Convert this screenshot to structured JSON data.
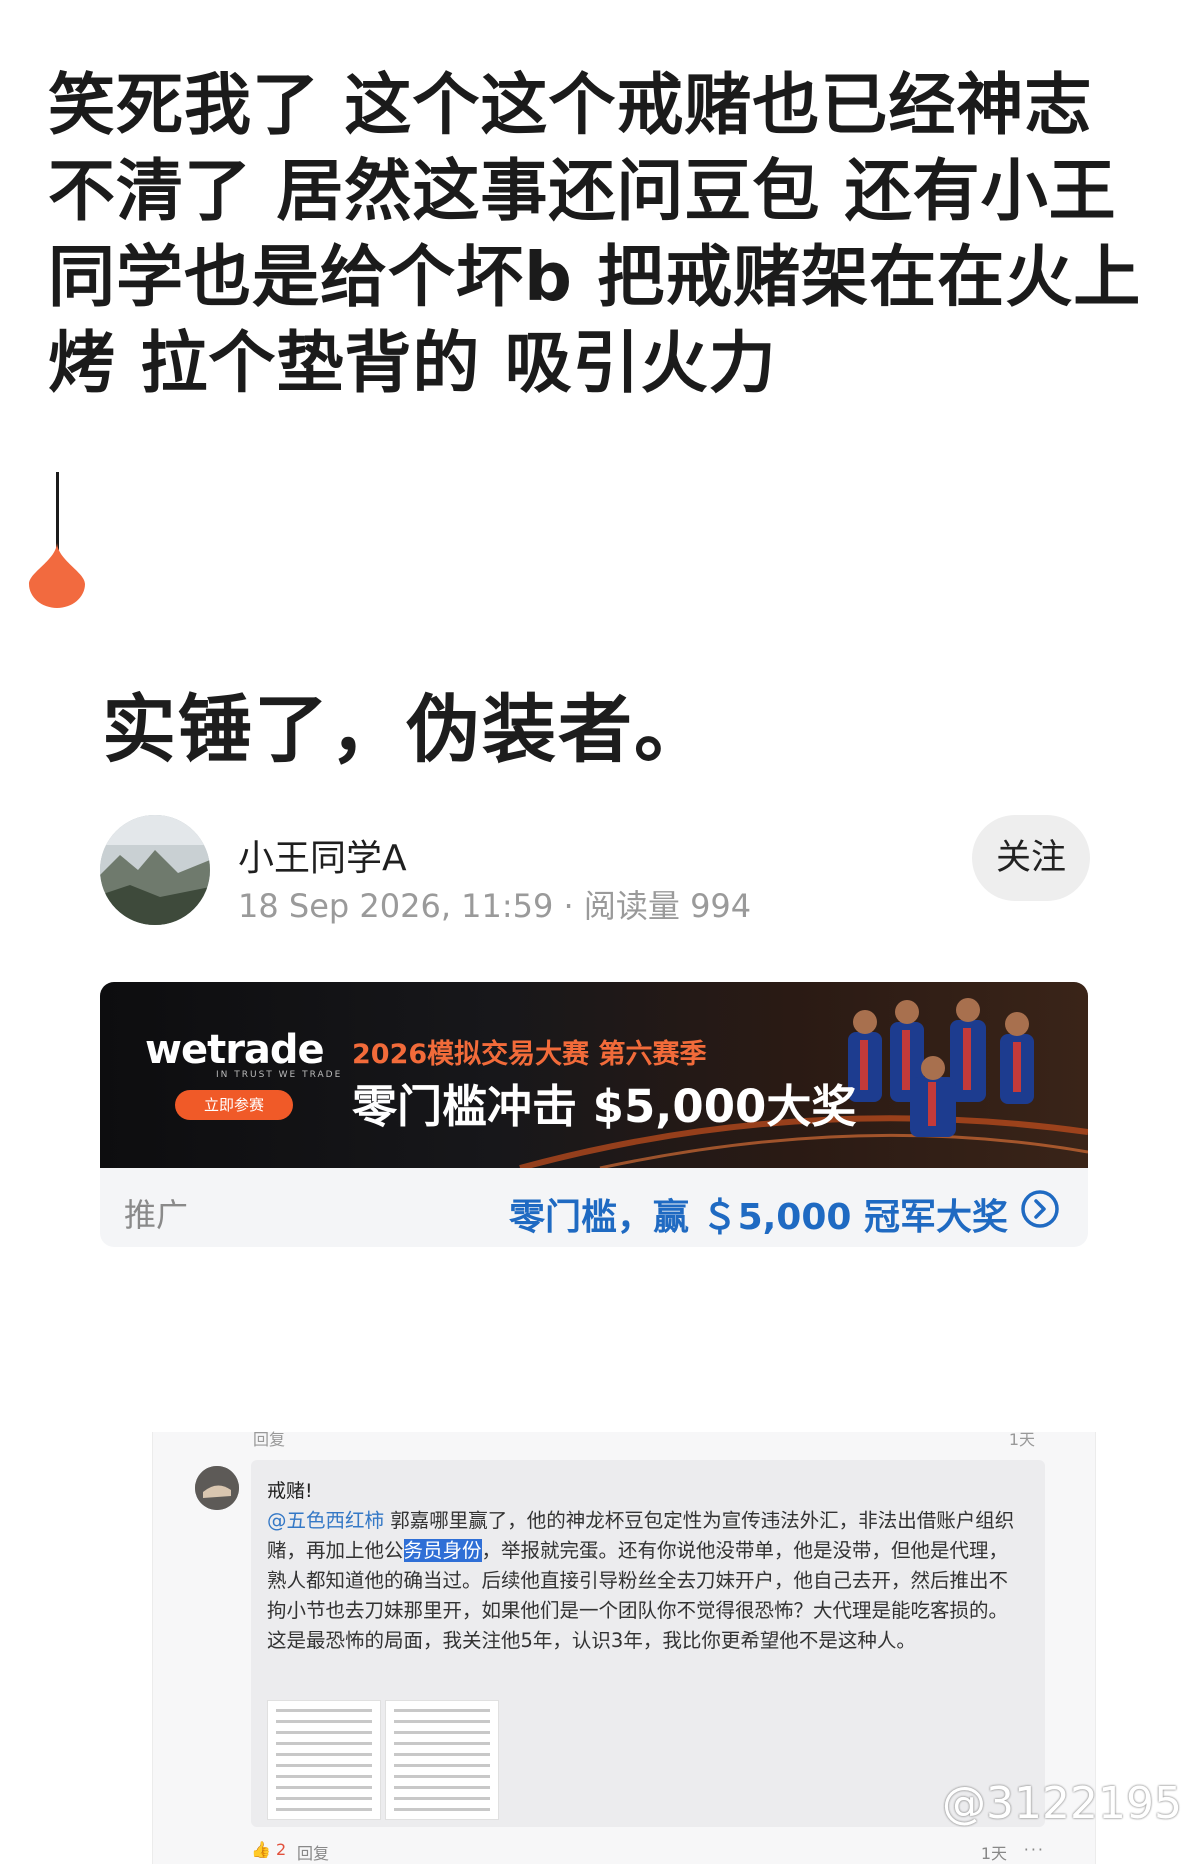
{
  "post": {
    "text": "笑死我了 这个这个戒赌也已经神志不清了 居然这事还问豆包  还有小王同学也是给个坏b 把戒赌架在在火上烤 拉个垫背的 吸引火力"
  },
  "article": {
    "headline": "实锤了，伪装者。",
    "author": {
      "name": "小王同学A",
      "meta": "18 Sep 2026, 11:59 · 阅读量 994",
      "follow_label": "关注"
    }
  },
  "ad": {
    "brand": "wetrade",
    "brand_tagline": "IN TRUST WE TRADE",
    "cta_label": "立即参赛",
    "line1": "2026模拟交易大赛 第六赛季",
    "line2": "零门槛冲击 $5,000大奖",
    "label": "推广",
    "footer_text": "零门槛，赢 ＄5,000 冠军大奖",
    "colors": {
      "accent": "#f05a28",
      "link": "#1f6ac2"
    }
  },
  "embedded_comment": {
    "header_left": "回复",
    "header_right": "1天",
    "title": "戒赌!",
    "mention": "@五色西红柿",
    "body_part1": " 郭嘉哪里赢了，他的神龙杯豆包定性为宣传违法外汇，非法出借账户组织赌，再加上他公",
    "body_highlight": "务员身份",
    "body_part2": "，举报就完蛋。还有你说他没带单，他是没带，但他是代理，熟人都知道他的确当过。后续他直接引导粉丝全去刀妹开户，他自己去开，然后推出不拘小节也去刀妹那里开，如果他们是一个团队你不觉得很恐怖？大代理是能吃客损的。这是最恐怖的局面，我关注他5年，认识3年，我比你更希望他不是这种人。",
    "likes": "2",
    "reply_label": "回复",
    "time": "1天",
    "more": "···"
  },
  "watermark": "@3122195"
}
